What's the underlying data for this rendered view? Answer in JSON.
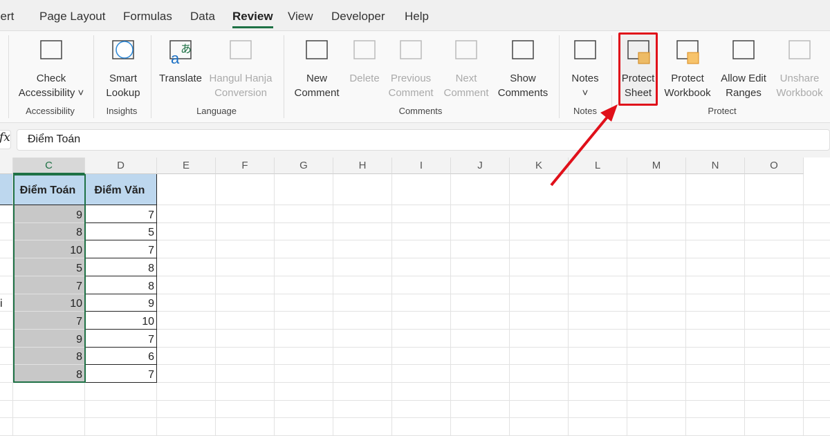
{
  "tabs": [
    "sert",
    "Page Layout",
    "Formulas",
    "Data",
    "Review",
    "View",
    "Developer",
    "Help"
  ],
  "active_tab": "Review",
  "ribbon": {
    "buttons": [
      {
        "l1": "Check",
        "l2": "Accessibility ˅",
        "icon": "accessibility-icon"
      },
      {
        "l1": "Smart",
        "l2": "Lookup",
        "icon": "smart-lookup-icon"
      },
      {
        "l1": "Translate",
        "l2": "",
        "icon": "translate-icon"
      },
      {
        "l1": "Hangul Hanja",
        "l2": "Conversion",
        "icon": "hanja-icon"
      },
      {
        "l1": "New",
        "l2": "Comment",
        "icon": "new-comment-icon"
      },
      {
        "l1": "Delete",
        "l2": "",
        "icon": "delete-comment-icon"
      },
      {
        "l1": "Previous",
        "l2": "Comment",
        "icon": "previous-comment-icon"
      },
      {
        "l1": "Next",
        "l2": "Comment",
        "icon": "next-comment-icon"
      },
      {
        "l1": "Show",
        "l2": "Comments",
        "icon": "show-comments-icon"
      },
      {
        "l1": "Notes",
        "l2": "˅",
        "icon": "notes-icon"
      },
      {
        "l1": "Protect",
        "l2": "Sheet",
        "icon": "protect-sheet-icon"
      },
      {
        "l1": "Protect",
        "l2": "Workbook",
        "icon": "protect-workbook-icon"
      },
      {
        "l1": "Allow Edit",
        "l2": "Ranges",
        "icon": "allow-edit-ranges-icon"
      },
      {
        "l1": "Unshare",
        "l2": "Workbook",
        "icon": "unshare-workbook-icon"
      }
    ],
    "groups": [
      "Accessibility",
      "Insights",
      "Language",
      "Comments",
      "Notes",
      "Protect"
    ]
  },
  "formula_bar": {
    "fx": "fx",
    "value": "Điểm Toán"
  },
  "columns": [
    "C",
    "D",
    "E",
    "F",
    "G",
    "H",
    "I",
    "J",
    "K",
    "L",
    "M",
    "N",
    "O"
  ],
  "table": {
    "headers": [
      "Điểm Toán",
      "Điểm Văn"
    ],
    "rows": [
      [
        9,
        7
      ],
      [
        8,
        5
      ],
      [
        10,
        7
      ],
      [
        5,
        8
      ],
      [
        7,
        8
      ],
      [
        10,
        9
      ],
      [
        7,
        10
      ],
      [
        9,
        7
      ],
      [
        8,
        6
      ],
      [
        8,
        7
      ]
    ],
    "col_b_fragment": "i"
  },
  "colors": {
    "accent": "#1e7145",
    "highlight": "#e0101a",
    "header_fill": "#bdd7ee"
  }
}
